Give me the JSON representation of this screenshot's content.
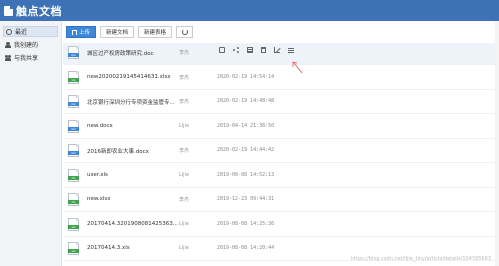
{
  "app": {
    "title": "触点文档"
  },
  "sidebar": {
    "items": [
      {
        "label": "最近",
        "icon": "clock-icon",
        "active": true
      },
      {
        "label": "我创建的",
        "icon": "user-icon",
        "active": false
      },
      {
        "label": "与我共享",
        "icon": "users-icon",
        "active": false
      }
    ]
  },
  "toolbar": {
    "upload_label": "上传",
    "new_doc_label": "新建文档",
    "new_sheet_label": "新建表格",
    "refresh_icon": "refresh-icon"
  },
  "files": [
    {
      "name": "城区过产权房政策研究.doc",
      "type": "doc",
      "owner": "李杰",
      "date": "",
      "hovered": true
    },
    {
      "name": "new20200219145414631.xlsx",
      "type": "xls",
      "owner": "李杰",
      "date": "2020-02-19 14:54:14"
    },
    {
      "name": "北京银行深圳分行专项资金监管专...",
      "type": "doc",
      "owner": "李杰",
      "date": "2020-02-19 14:48:48"
    },
    {
      "name": "new.docx",
      "type": "doc",
      "owner": "Lijie",
      "date": "2019-04-14 21:38:50"
    },
    {
      "name": "2016新即农业大事.docx",
      "type": "doc",
      "owner": "李杰",
      "date": "2020-02-19 14:44:42"
    },
    {
      "name": "user.xls",
      "type": "xls",
      "owner": "Lijie",
      "date": "2019-08-08 14:52:13"
    },
    {
      "name": "new.xlsx",
      "type": "xls",
      "owner": "李杰",
      "date": "2019-12-23 09:44:31"
    },
    {
      "name": "20170414.3201908081425363...",
      "type": "xls",
      "owner": "Lijie",
      "date": "2019-08-08 14:25:36"
    },
    {
      "name": "20170414.3.xls",
      "type": "xls",
      "owner": "Lijie",
      "date": "2019-08-08 14:20:44"
    }
  ],
  "row_actions": [
    "info-icon",
    "share-icon",
    "grid-icon",
    "trash-icon",
    "edit-icon",
    "list-icon"
  ],
  "colors": {
    "header": "#3d73b6",
    "doc": "#3d86d8",
    "xls": "#3fa34d",
    "annotation": "#d9534f"
  },
  "watermark": "https://blog.csdn.net/lijie_tiny/article/details/104395693"
}
